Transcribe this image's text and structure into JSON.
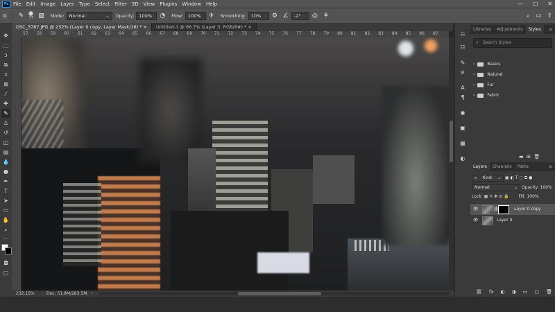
{
  "menubar": {
    "app_logo": "Ps",
    "items": [
      "File",
      "Edit",
      "Image",
      "Layer",
      "Type",
      "Select",
      "Filter",
      "3D",
      "View",
      "Plugins",
      "Window",
      "Help"
    ],
    "window_controls": [
      "—",
      "▢",
      "✕"
    ]
  },
  "options": {
    "brush_size": "77",
    "mode_label": "Mode:",
    "mode_value": "Normal",
    "opacity_label": "Opacity:",
    "opacity_value": "100%",
    "flow_label": "Flow:",
    "flow_value": "100%",
    "smoothing_label": "Smoothing:",
    "smoothing_value": "10%",
    "angle_value": "-2°"
  },
  "tabs": [
    {
      "label": "DSC_3787.JPG @ 232% (Layer 0 copy, Layer Mask/16) *",
      "close": "×"
    },
    {
      "label": "Untitled-1 @ 66.7% (Layer 3, RGB/8#) *",
      "close": "×"
    }
  ],
  "ruler": {
    "ticks": [
      "57",
      "58",
      "59",
      "60",
      "61",
      "62",
      "63",
      "64",
      "65",
      "66",
      "67",
      "68",
      "69",
      "70",
      "71",
      "72",
      "73",
      "74",
      "75",
      "76",
      "77",
      "78",
      "79",
      "80",
      "81",
      "82",
      "83",
      "84",
      "85",
      "86",
      "87"
    ]
  },
  "status": {
    "zoom": "232.15%",
    "doc": "Doc: 51.9M/283.5M"
  },
  "panels": {
    "top_tabs": [
      "Libraries",
      "Adjustments",
      "Styles"
    ],
    "search_placeholder": "Search Styles",
    "style_groups": [
      "Basics",
      "Natural",
      "Fur",
      "Fabric"
    ],
    "layer_tabs": [
      "Layers",
      "Channels",
      "Paths"
    ],
    "kind_label": "Kind",
    "blend_mode": "Normal",
    "opacity_label": "Opacity:",
    "opacity_value": "100%",
    "lock_label": "Lock:",
    "fill_label": "Fill:",
    "fill_value": "100%",
    "layers": [
      {
        "name": "Layer 0 copy"
      },
      {
        "name": "Layer 0"
      }
    ],
    "footer_icons": [
      "fx",
      "◐",
      "◑",
      "▭",
      "▢",
      "🗑"
    ]
  },
  "colors": {
    "accent": "#31a8ff",
    "ui_bg": "#535353",
    "panel_bg": "#3a3a3a"
  }
}
